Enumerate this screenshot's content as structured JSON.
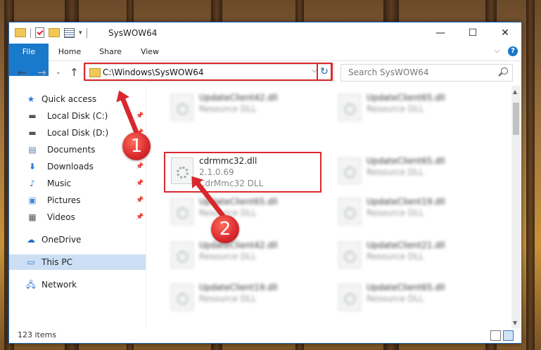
{
  "window": {
    "title": "SysWOW64",
    "controls": {
      "minimize": "—",
      "maximize": "☐",
      "close": "✕"
    }
  },
  "ribbon": {
    "tabs": [
      "File",
      "Home",
      "Share",
      "View"
    ],
    "expand_icon": "chevron-down-icon",
    "help_icon": "help-icon"
  },
  "address": {
    "path": "C:\\Windows\\SysWOW64",
    "search_placeholder": "Search SysWOW64"
  },
  "sidebar": {
    "items": [
      {
        "label": "Quick access",
        "icon": "star-icon",
        "pinned": false
      },
      {
        "label": "Local Disk (C:)",
        "icon": "drive-icon",
        "pinned": true
      },
      {
        "label": "Local Disk (D:)",
        "icon": "drive-icon",
        "pinned": true
      },
      {
        "label": "Documents",
        "icon": "documents-icon",
        "pinned": true
      },
      {
        "label": "Downloads",
        "icon": "download-icon",
        "pinned": true
      },
      {
        "label": "Music",
        "icon": "music-icon",
        "pinned": true
      },
      {
        "label": "Pictures",
        "icon": "pictures-icon",
        "pinned": true
      },
      {
        "label": "Videos",
        "icon": "videos-icon",
        "pinned": true
      },
      {
        "label": "OneDrive",
        "icon": "cloud-icon",
        "pinned": false
      },
      {
        "label": "This PC",
        "icon": "computer-icon",
        "pinned": false,
        "selected": true
      },
      {
        "label": "Network",
        "icon": "network-icon",
        "pinned": false
      }
    ]
  },
  "files": [
    {
      "name": "UpdateClient42.dll",
      "type": "Resource DLL",
      "blurred": true
    },
    {
      "name": "UpdateClient65.dll",
      "type": "Resource DLL",
      "blurred": true
    },
    {
      "name": "cdrmmc32.dll",
      "version": "2.1.0.69",
      "description": "CdrMmc32 DLL",
      "blurred": false,
      "highlighted": true
    },
    {
      "name": "UpdateClient65.dll",
      "type": "Resource DLL",
      "blurred": true
    },
    {
      "name": "UpdateClient65.dll",
      "type": "Resource DLL",
      "blurred": true
    },
    {
      "name": "UpdateClient19.dll",
      "type": "Resource DLL",
      "blurred": true
    },
    {
      "name": "UpdateClient42.dll",
      "type": "Resource DLL",
      "blurred": true
    },
    {
      "name": "UpdateClient21.dll",
      "type": "Resource DLL",
      "blurred": true
    },
    {
      "name": "UpdateClient19.dll",
      "type": "Resource DLL",
      "blurred": true
    },
    {
      "name": "UpdateClient65.dll",
      "type": "Resource DLL",
      "blurred": true
    }
  ],
  "status": {
    "item_count": "123 items"
  },
  "callouts": {
    "first": "1",
    "second": "2"
  },
  "colors": {
    "accent": "#1979ca",
    "highlight": "#d9282d",
    "selection": "#ccdff4"
  }
}
